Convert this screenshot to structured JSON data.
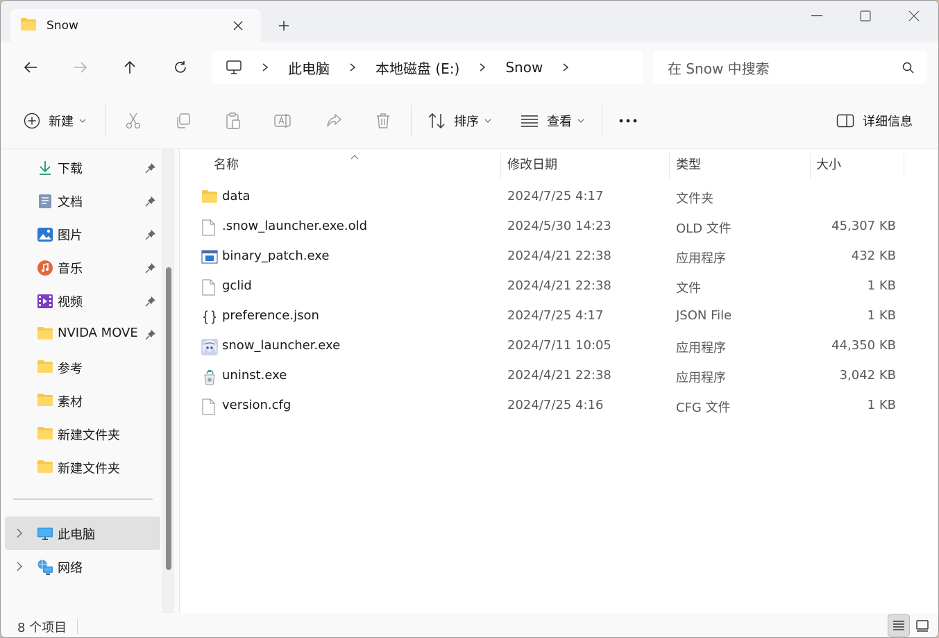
{
  "tab": {
    "title": "Snow"
  },
  "breadcrumb": [
    "此电脑",
    "本地磁盘 (E:)",
    "Snow"
  ],
  "search": {
    "placeholder": "在 Snow 中搜索"
  },
  "toolbar": {
    "new_label": "新建",
    "sort_label": "排序",
    "view_label": "查看",
    "details_label": "详细信息"
  },
  "sidebar": {
    "quick_access": [
      {
        "label": "下载",
        "icon": "download-icon",
        "pinned": true
      },
      {
        "label": "文档",
        "icon": "document-icon",
        "pinned": true
      },
      {
        "label": "图片",
        "icon": "pictures-icon",
        "pinned": true
      },
      {
        "label": "音乐",
        "icon": "music-icon",
        "pinned": true
      },
      {
        "label": "视频",
        "icon": "video-icon",
        "pinned": true
      },
      {
        "label": "NVIDA MOVE",
        "icon": "folder-icon",
        "pinned": true
      },
      {
        "label": "参考",
        "icon": "folder-icon",
        "pinned": false
      },
      {
        "label": "素材",
        "icon": "folder-icon",
        "pinned": false
      },
      {
        "label": "新建文件夹",
        "icon": "folder-icon",
        "pinned": false
      },
      {
        "label": "新建文件夹",
        "icon": "folder-icon",
        "pinned": false
      }
    ],
    "this_pc": "此电脑",
    "network": "网络"
  },
  "columns": {
    "name": "名称",
    "date": "修改日期",
    "type": "类型",
    "size": "大小"
  },
  "files": [
    {
      "name": "data",
      "date": "2024/7/25 4:17",
      "type": "文件夹",
      "size": "",
      "icon": "folder-icon"
    },
    {
      "name": ".snow_launcher.exe.old",
      "date": "2024/5/30 14:23",
      "type": "OLD 文件",
      "size": "45,307 KB",
      "icon": "file-icon"
    },
    {
      "name": "binary_patch.exe",
      "date": "2024/4/21 22:38",
      "type": "应用程序",
      "size": "432 KB",
      "icon": "app-window-icon"
    },
    {
      "name": "gclid",
      "date": "2024/4/21 22:38",
      "type": "文件",
      "size": "1 KB",
      "icon": "file-icon"
    },
    {
      "name": "preference.json",
      "date": "2024/7/25 4:17",
      "type": "JSON File",
      "size": "1 KB",
      "icon": "json-file-icon"
    },
    {
      "name": "snow_launcher.exe",
      "date": "2024/7/11 10:05",
      "type": "应用程序",
      "size": "44,350 KB",
      "icon": "anime-app-icon"
    },
    {
      "name": "uninst.exe",
      "date": "2024/4/21 22:38",
      "type": "应用程序",
      "size": "3,042 KB",
      "icon": "uninstaller-icon"
    },
    {
      "name": "version.cfg",
      "date": "2024/7/25 4:16",
      "type": "CFG 文件",
      "size": "1 KB",
      "icon": "file-icon"
    }
  ],
  "status": {
    "item_count": "8 个项目"
  },
  "colors": {
    "folder": "#f4c84a",
    "accent": "#0067c0",
    "selection": "#e1e1e1"
  }
}
